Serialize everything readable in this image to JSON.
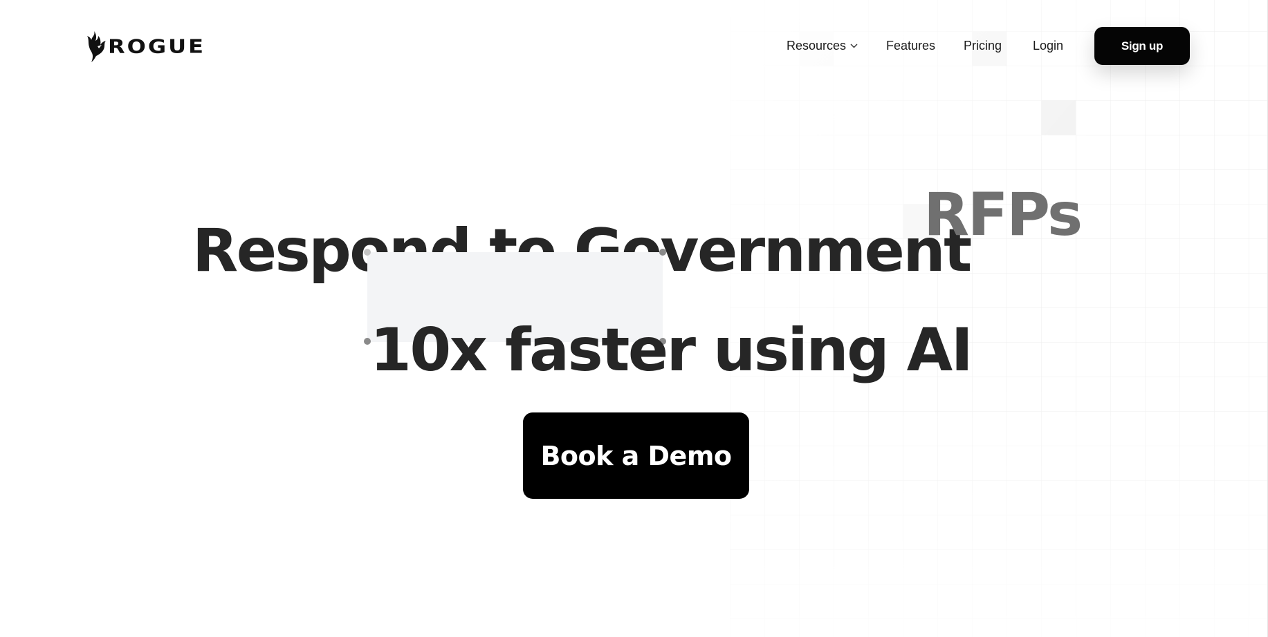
{
  "brand": {
    "name": "ROGUE",
    "icon": "rogue-flame-logo-icon",
    "color": "#111111"
  },
  "nav": {
    "items": [
      {
        "label": "Resources",
        "has_dropdown": true,
        "icon": "chevron-down-icon"
      },
      {
        "label": "Features"
      },
      {
        "label": "Pricing"
      },
      {
        "label": "Login"
      }
    ],
    "signup_label": "Sign up"
  },
  "hero": {
    "line1": "Respond to Government",
    "line1_accent": "RFPs",
    "line2": "10x faster using AI",
    "line2_highlight": "10x faster",
    "text_color": "#262626",
    "accent_color": "#707070",
    "highlight_bg": "#f3f4f6"
  },
  "cta": {
    "label": "Book a Demo",
    "bg_color": "#000000"
  }
}
